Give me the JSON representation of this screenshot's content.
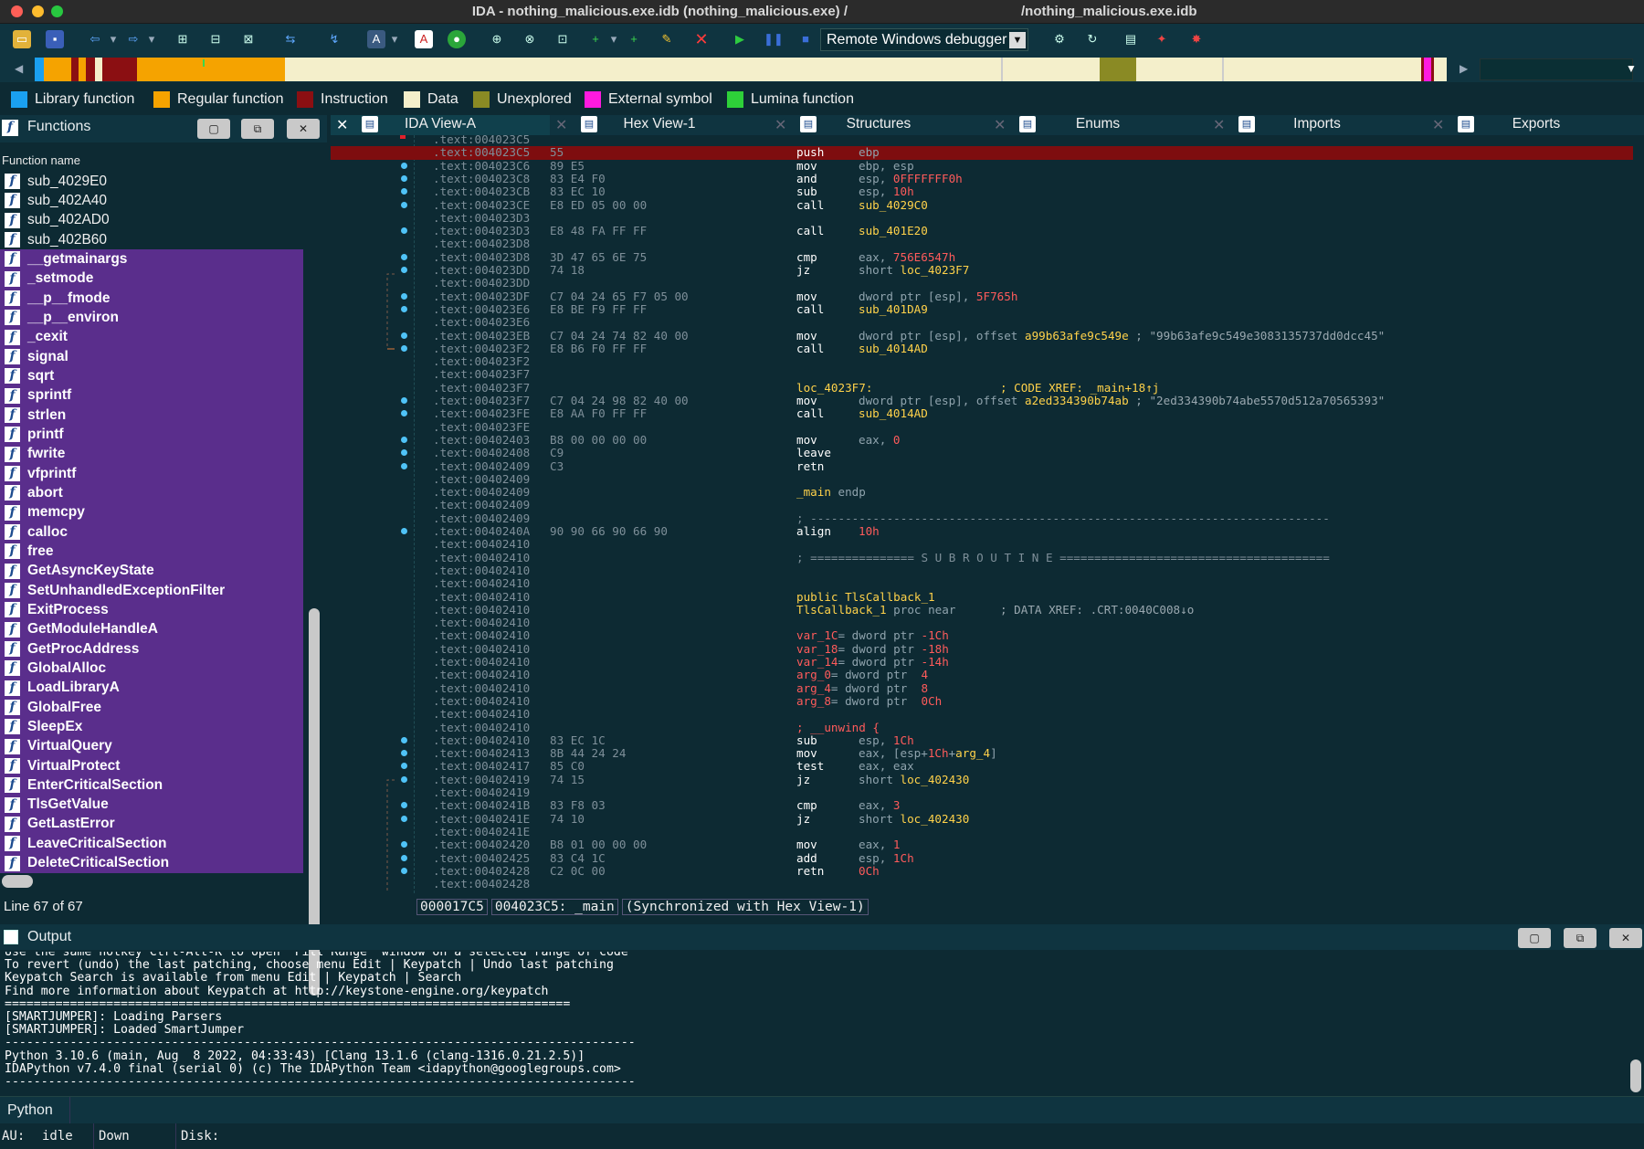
{
  "window": {
    "title_left": "IDA - nothing_malicious.exe.idb (nothing_malicious.exe) /",
    "title_right": "/nothing_malicious.exe.idb"
  },
  "toolbar": {
    "debugger": "Remote Windows debugger"
  },
  "legend": [
    {
      "label": "Library function",
      "color": "#1aa0f0"
    },
    {
      "label": "Regular function",
      "color": "#f5a300"
    },
    {
      "label": "Instruction",
      "color": "#8b0f12"
    },
    {
      "label": "Data",
      "color": "#f4efcb"
    },
    {
      "label": "Unexplored",
      "color": "#8a8a24"
    },
    {
      "label": "External symbol",
      "color": "#ff1adf"
    },
    {
      "label": "Lumina function",
      "color": "#2ed039"
    }
  ],
  "functions": {
    "title": "Functions",
    "column": "Function name",
    "line_info": "Line 67 of 67",
    "items": [
      {
        "name": "sub_4029E0",
        "kind": "regular"
      },
      {
        "name": "sub_402A40",
        "kind": "regular"
      },
      {
        "name": "sub_402AD0",
        "kind": "regular"
      },
      {
        "name": "sub_402B60",
        "kind": "regular"
      },
      {
        "name": "__getmainargs",
        "kind": "library"
      },
      {
        "name": "_setmode",
        "kind": "library"
      },
      {
        "name": "__p__fmode",
        "kind": "library"
      },
      {
        "name": "__p__environ",
        "kind": "library"
      },
      {
        "name": "_cexit",
        "kind": "library"
      },
      {
        "name": "signal",
        "kind": "library"
      },
      {
        "name": "sqrt",
        "kind": "library"
      },
      {
        "name": "sprintf",
        "kind": "library"
      },
      {
        "name": "strlen",
        "kind": "library"
      },
      {
        "name": "printf",
        "kind": "library"
      },
      {
        "name": "fwrite",
        "kind": "library"
      },
      {
        "name": "vfprintf",
        "kind": "library"
      },
      {
        "name": "abort",
        "kind": "library"
      },
      {
        "name": "memcpy",
        "kind": "library"
      },
      {
        "name": "calloc",
        "kind": "library"
      },
      {
        "name": "free",
        "kind": "library"
      },
      {
        "name": "GetAsyncKeyState",
        "kind": "library"
      },
      {
        "name": "SetUnhandledExceptionFilter",
        "kind": "library"
      },
      {
        "name": "ExitProcess",
        "kind": "library"
      },
      {
        "name": "GetModuleHandleA",
        "kind": "library"
      },
      {
        "name": "GetProcAddress",
        "kind": "library"
      },
      {
        "name": "GlobalAlloc",
        "kind": "library"
      },
      {
        "name": "LoadLibraryA",
        "kind": "library"
      },
      {
        "name": "GlobalFree",
        "kind": "library"
      },
      {
        "name": "SleepEx",
        "kind": "library"
      },
      {
        "name": "VirtualQuery",
        "kind": "library"
      },
      {
        "name": "VirtualProtect",
        "kind": "library"
      },
      {
        "name": "EnterCriticalSection",
        "kind": "library"
      },
      {
        "name": "TlsGetValue",
        "kind": "library"
      },
      {
        "name": "GetLastError",
        "kind": "library"
      },
      {
        "name": "LeaveCriticalSection",
        "kind": "library"
      },
      {
        "name": "DeleteCriticalSection",
        "kind": "library"
      }
    ]
  },
  "tabs": [
    {
      "label": "IDA View-A",
      "active": true
    },
    {
      "label": "Hex View-1",
      "active": false
    },
    {
      "label": "Structures",
      "active": false
    },
    {
      "label": "Enums",
      "active": false
    },
    {
      "label": "Imports",
      "active": false
    },
    {
      "label": "Exports",
      "active": false
    }
  ],
  "disasm": [
    {
      "addr": ".text:004023C5",
      "bytes": "",
      "mn": "",
      "op": ""
    },
    {
      "addr": ".text:004023C5",
      "bytes": "55",
      "mn": "push",
      "op": "ebp",
      "hl": true
    },
    {
      "addr": ".text:004023C6",
      "bytes": "89 E5",
      "mn": "mov",
      "op": "ebp, esp"
    },
    {
      "addr": ".text:004023C8",
      "bytes": "83 E4 F0",
      "mn": "and",
      "op": "esp, ",
      "num": "0FFFFFFF0h"
    },
    {
      "addr": ".text:004023CB",
      "bytes": "83 EC 10",
      "mn": "sub",
      "op": "esp, ",
      "num": "10h"
    },
    {
      "addr": ".text:004023CE",
      "bytes": "E8 ED 05 00 00",
      "mn": "call",
      "op": "",
      "sym": "sub_4029C0"
    },
    {
      "addr": ".text:004023D3",
      "bytes": "",
      "mn": "",
      "op": ""
    },
    {
      "addr": ".text:004023D3",
      "bytes": "E8 48 FA FF FF",
      "mn": "call",
      "op": "",
      "sym": "sub_401E20"
    },
    {
      "addr": ".text:004023D8",
      "bytes": "",
      "mn": "",
      "op": ""
    },
    {
      "addr": ".text:004023D8",
      "bytes": "3D 47 65 6E 75",
      "mn": "cmp",
      "op": "eax, ",
      "num": "756E6547h"
    },
    {
      "addr": ".text:004023DD",
      "bytes": "74 18",
      "mn": "jz",
      "op": "short ",
      "sym": "loc_4023F7"
    },
    {
      "addr": ".text:004023DD",
      "bytes": "",
      "mn": "",
      "op": ""
    },
    {
      "addr": ".text:004023DF",
      "bytes": "C7 04 24 65 F7 05 00",
      "mn": "mov",
      "op": "dword ptr [esp], ",
      "num": "5F765h"
    },
    {
      "addr": ".text:004023E6",
      "bytes": "E8 BE F9 FF FF",
      "mn": "call",
      "op": "",
      "sym": "sub_401DA9"
    },
    {
      "addr": ".text:004023E6",
      "bytes": "",
      "mn": "",
      "op": ""
    },
    {
      "addr": ".text:004023EB",
      "bytes": "C7 04 24 74 82 40 00",
      "mn": "mov",
      "op": "dword ptr [esp], offset ",
      "sym": "a99b63afe9c549e",
      "cm": " ; \"99b63afe9c549e3083135737dd0dcc45\""
    },
    {
      "addr": ".text:004023F2",
      "bytes": "E8 B6 F0 FF FF",
      "mn": "call",
      "op": "",
      "sym": "sub_4014AD"
    },
    {
      "addr": ".text:004023F2",
      "bytes": "",
      "mn": "",
      "op": ""
    },
    {
      "addr": ".text:004023F7",
      "bytes": "",
      "mn": "",
      "op": ""
    },
    {
      "addr": ".text:004023F7",
      "bytes": "",
      "lbl": "loc_4023F7:",
      "xref": "; CODE XREF: _main+18↑j"
    },
    {
      "addr": ".text:004023F7",
      "bytes": "C7 04 24 98 82 40 00",
      "mn": "mov",
      "op": "dword ptr [esp], offset ",
      "sym": "a2ed334390b74ab",
      "cm": " ; \"2ed334390b74abe5570d512a70565393\""
    },
    {
      "addr": ".text:004023FE",
      "bytes": "E8 AA F0 FF FF",
      "mn": "call",
      "op": "",
      "sym": "sub_4014AD"
    },
    {
      "addr": ".text:004023FE",
      "bytes": "",
      "mn": "",
      "op": ""
    },
    {
      "addr": ".text:00402403",
      "bytes": "B8 00 00 00 00",
      "mn": "mov",
      "op": "eax, ",
      "num": "0"
    },
    {
      "addr": ".text:00402408",
      "bytes": "C9",
      "mn": "leave",
      "op": ""
    },
    {
      "addr": ".text:00402409",
      "bytes": "C3",
      "mn": "retn",
      "op": ""
    },
    {
      "addr": ".text:00402409",
      "bytes": "",
      "mn": "",
      "op": ""
    },
    {
      "addr": ".text:00402409",
      "bytes": "",
      "lbl": "_main",
      "lbl2": " endp"
    },
    {
      "addr": ".text:00402409",
      "bytes": "",
      "mn": "",
      "op": ""
    },
    {
      "addr": ".text:00402409",
      "bytes": "",
      "sep": "; ---------------------------------------------------------------------------"
    },
    {
      "addr": ".text:0040240A",
      "bytes": "90 90 66 90 66 90",
      "mn": "align",
      "op": "",
      "num": "10h"
    },
    {
      "addr": ".text:00402410",
      "bytes": "",
      "mn": "",
      "op": ""
    },
    {
      "addr": ".text:00402410",
      "bytes": "",
      "sep": "; =============== S U B R O U T I N E ======================================="
    },
    {
      "addr": ".text:00402410",
      "bytes": "",
      "mn": "",
      "op": ""
    },
    {
      "addr": ".text:00402410",
      "bytes": "",
      "mn": "",
      "op": ""
    },
    {
      "addr": ".text:00402410",
      "bytes": "",
      "lbl": "public TlsCallback_1"
    },
    {
      "addr": ".text:00402410",
      "bytes": "",
      "lbl": "TlsCallback_1",
      "lbl2": " proc near",
      "xref": "; DATA XREF: .CRT:0040C008↓o"
    },
    {
      "addr": ".text:00402410",
      "bytes": "",
      "mn": "",
      "op": ""
    },
    {
      "addr": ".text:00402410",
      "bytes": "",
      "var": "var_1C",
      "vt": "= dword ptr ",
      "num": "-1Ch"
    },
    {
      "addr": ".text:00402410",
      "bytes": "",
      "var": "var_18",
      "vt": "= dword ptr ",
      "num": "-18h"
    },
    {
      "addr": ".text:00402410",
      "bytes": "",
      "var": "var_14",
      "vt": "= dword ptr ",
      "num": "-14h"
    },
    {
      "addr": ".text:00402410",
      "bytes": "",
      "var": "arg_0",
      "vt": "= dword ptr  ",
      "num": "4"
    },
    {
      "addr": ".text:00402410",
      "bytes": "",
      "var": "arg_4",
      "vt": "= dword ptr  ",
      "num": "8"
    },
    {
      "addr": ".text:00402410",
      "bytes": "",
      "var": "arg_8",
      "vt": "= dword ptr  ",
      "num": "0Ch"
    },
    {
      "addr": ".text:00402410",
      "bytes": "",
      "mn": "",
      "op": ""
    },
    {
      "addr": ".text:00402410",
      "bytes": "",
      "sep2": "; __unwind {"
    },
    {
      "addr": ".text:00402410",
      "bytes": "83 EC 1C",
      "mn": "sub",
      "op": "esp, ",
      "num": "1Ch"
    },
    {
      "addr": ".text:00402413",
      "bytes": "8B 44 24 24",
      "mn": "mov",
      "op": "eax, [esp+",
      "num": "1Ch",
      "op2": "+",
      "sym2": "arg_4",
      "op3": "]"
    },
    {
      "addr": ".text:00402417",
      "bytes": "85 C0",
      "mn": "test",
      "op": "eax, eax"
    },
    {
      "addr": ".text:00402419",
      "bytes": "74 15",
      "mn": "jz",
      "op": "short ",
      "sym": "loc_402430"
    },
    {
      "addr": ".text:00402419",
      "bytes": "",
      "mn": "",
      "op": ""
    },
    {
      "addr": ".text:0040241B",
      "bytes": "83 F8 03",
      "mn": "cmp",
      "op": "eax, ",
      "num": "3"
    },
    {
      "addr": ".text:0040241E",
      "bytes": "74 10",
      "mn": "jz",
      "op": "short ",
      "sym": "loc_402430"
    },
    {
      "addr": ".text:0040241E",
      "bytes": "",
      "mn": "",
      "op": ""
    },
    {
      "addr": ".text:00402420",
      "bytes": "B8 01 00 00 00",
      "mn": "mov",
      "op": "eax, ",
      "num": "1"
    },
    {
      "addr": ".text:00402425",
      "bytes": "83 C4 1C",
      "mn": "add",
      "op": "esp, ",
      "num": "1Ch"
    },
    {
      "addr": ".text:00402428",
      "bytes": "C2 0C 00",
      "mn": "retn",
      "op": "",
      "num": "0Ch"
    },
    {
      "addr": ".text:00402428",
      "bytes": "",
      "mn": "",
      "op": ""
    }
  ],
  "status": {
    "offset": "000017C5",
    "location": "004023C5: _main",
    "sync": "(Synchronized with Hex View-1)"
  },
  "output": {
    "title": "Output",
    "lines": [
      "Use the same hotkey Ctrl-Alt-K to open 'Fill Range' window on a selected range of code",
      "To revert (undo) the last patching, choose menu Edit | Keypatch | Undo last patching",
      "Keypatch Search is available from menu Edit | Keypatch | Search",
      "Find more information about Keypatch at http://keystone-engine.org/keypatch",
      "==============================================================================",
      "[SMARTJUMPER]: Loading Parsers",
      "[SMARTJUMPER]: Loaded SmartJumper",
      "---------------------------------------------------------------------------------------",
      "Python 3.10.6 (main, Aug  8 2022, 04:33:43) [Clang 13.1.6 (clang-1316.0.21.2.5)]",
      "IDAPython v7.4.0 final (serial 0) (c) The IDAPython Team <idapython@googlegroups.com>",
      "---------------------------------------------------------------------------------------"
    ],
    "input_label": "Python"
  },
  "statusbar": {
    "au": "AU:",
    "au_state": "idle",
    "direction": "Down",
    "disk": "Disk:"
  }
}
